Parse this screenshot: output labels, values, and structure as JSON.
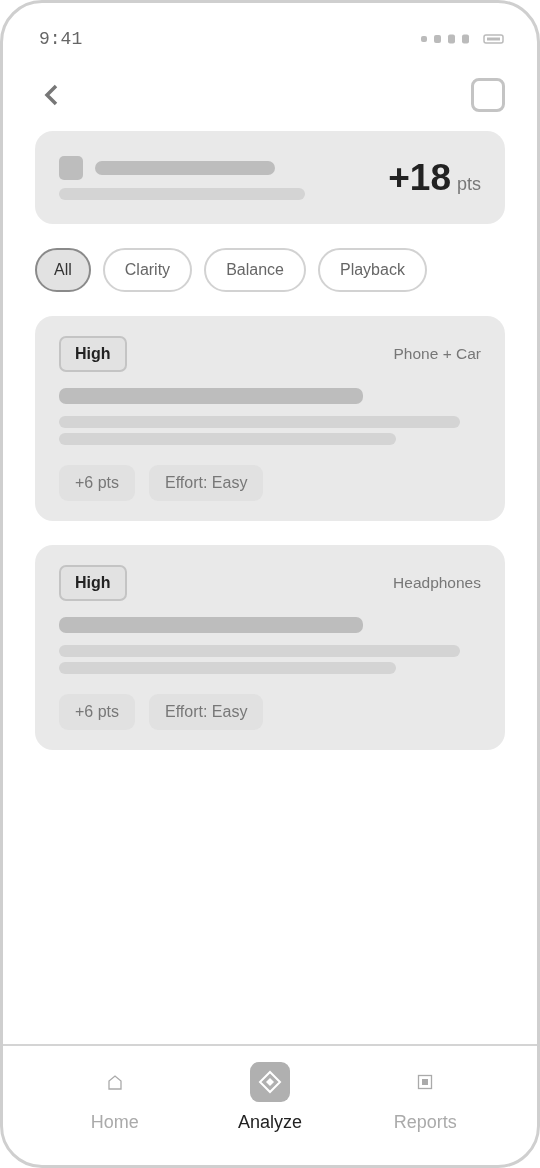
{
  "status_bar": {
    "time": "9:41"
  },
  "summary": {
    "score": "+18",
    "unit": "pts"
  },
  "filters": [
    {
      "label": "All",
      "selected": true
    },
    {
      "label": "Clarity",
      "selected": false
    },
    {
      "label": "Balance",
      "selected": false
    },
    {
      "label": "Playback",
      "selected": false
    }
  ],
  "cards": [
    {
      "priority": "High",
      "device": "Phone + Car",
      "points": "+6 pts",
      "effort": "Effort: Easy"
    },
    {
      "priority": "High",
      "device": "Headphones",
      "points": "+6 pts",
      "effort": "Effort: Easy"
    }
  ],
  "tabs": [
    {
      "kind": "home",
      "label": "Home",
      "selected": false
    },
    {
      "kind": "analyze",
      "label": "Analyze",
      "selected": true
    },
    {
      "kind": "reports",
      "label": "Reports",
      "selected": false
    }
  ]
}
